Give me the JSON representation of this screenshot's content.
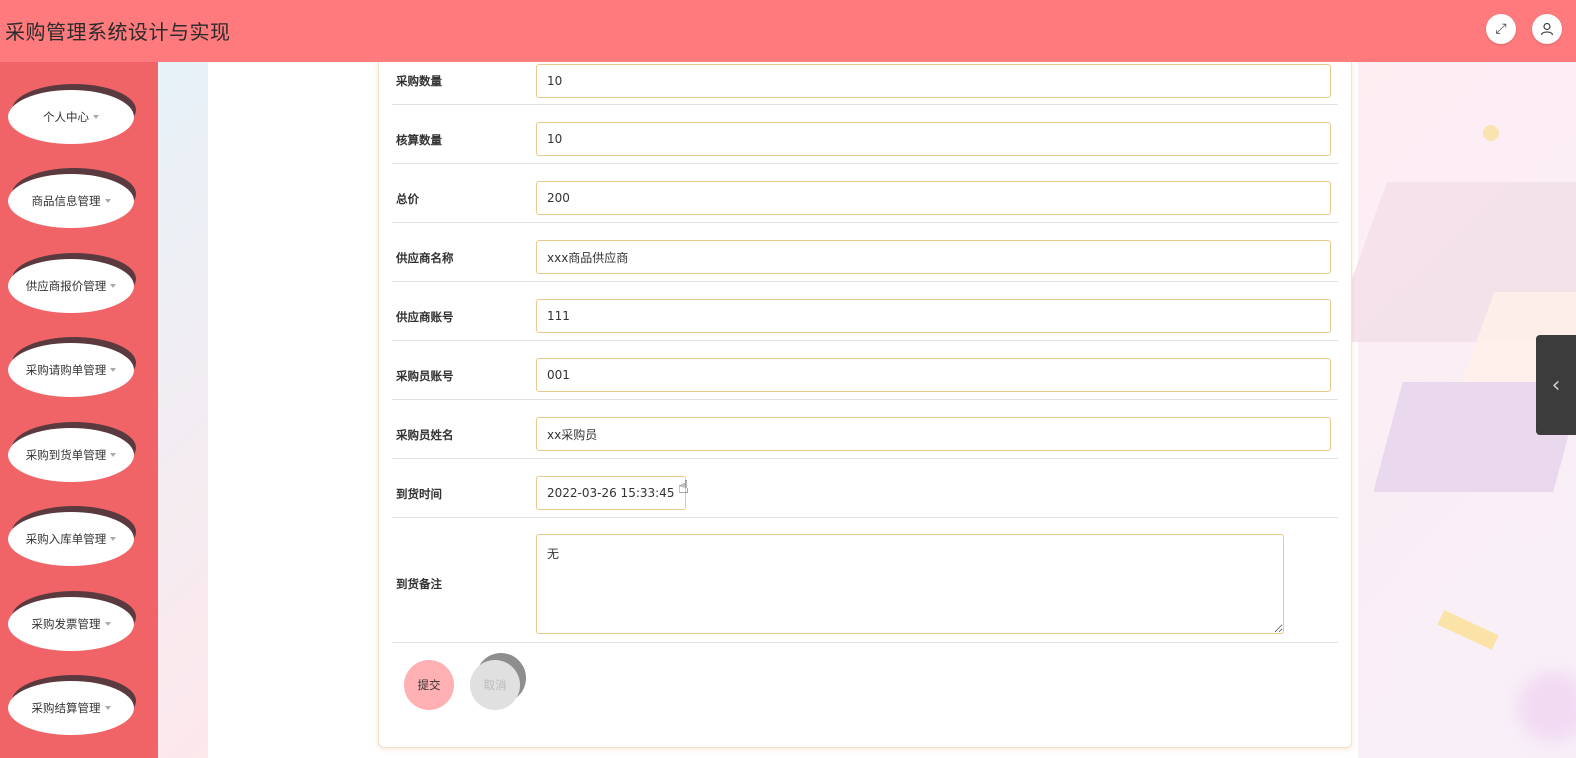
{
  "header": {
    "title": "采购管理系统设计与实现",
    "fullscreen_icon": "⤢",
    "user_icon": "👤"
  },
  "sidebar": {
    "items": [
      {
        "label": "个人中心"
      },
      {
        "label": "商品信息管理"
      },
      {
        "label": "供应商报价管理"
      },
      {
        "label": "采购请购单管理"
      },
      {
        "label": "采购到货单管理"
      },
      {
        "label": "采购入库单管理"
      },
      {
        "label": "采购发票管理"
      },
      {
        "label": "采购结算管理"
      }
    ]
  },
  "form": {
    "fields": [
      {
        "label": "采购数量",
        "value": "10"
      },
      {
        "label": "核算数量",
        "value": "10"
      },
      {
        "label": "总价",
        "value": "200"
      },
      {
        "label": "供应商名称",
        "value": "xxx商品供应商"
      },
      {
        "label": "供应商账号",
        "value": "111"
      },
      {
        "label": "采购员账号",
        "value": "001"
      },
      {
        "label": "采购员姓名",
        "value": "xx采购员"
      },
      {
        "label": "到货时间",
        "value": "2022-03-26 15:33:45"
      }
    ],
    "remark": {
      "label": "到货备注",
      "value": "无"
    },
    "submit_label": "提交",
    "cancel_label": "取消"
  },
  "side_tab": {
    "icon": "‹"
  },
  "colors": {
    "header": "#ff7a7d",
    "sidebar": "#f06468",
    "input_border": "#e9c98c",
    "submit": "#ffb0b2"
  }
}
